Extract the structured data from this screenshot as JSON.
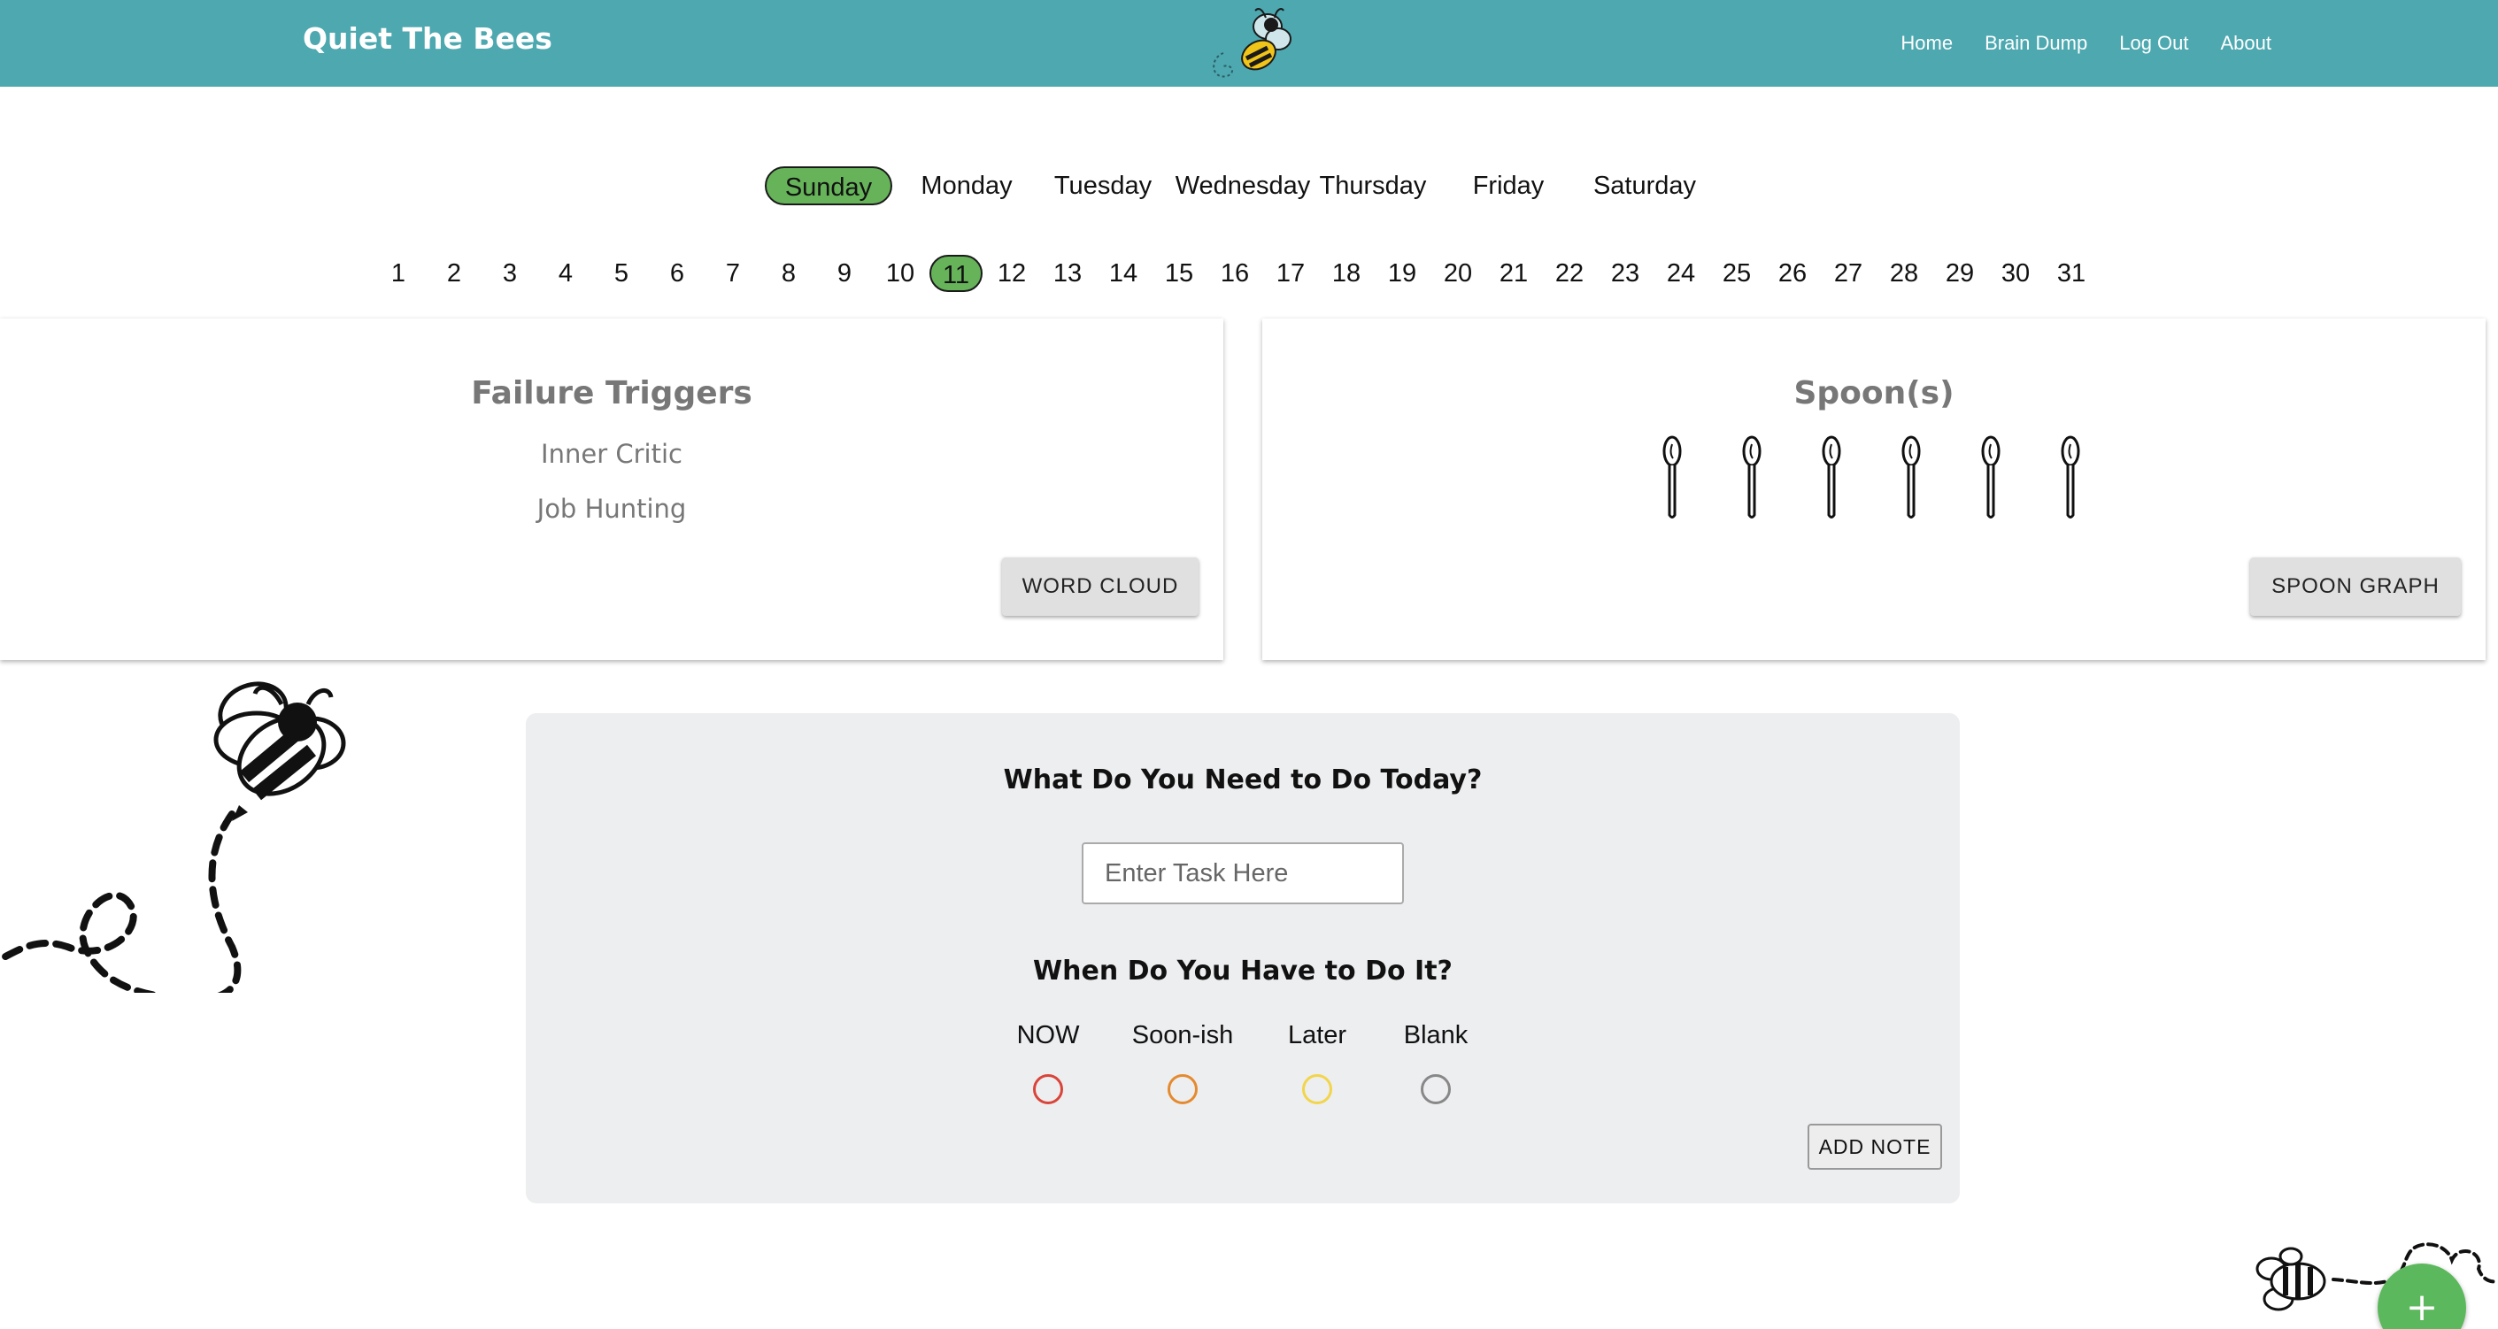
{
  "brand": "Quiet The Bees",
  "nav": {
    "links": [
      "Home",
      "Brain Dump",
      "Log Out",
      "About"
    ]
  },
  "week": {
    "days": [
      "Sunday",
      "Monday",
      "Tuesday",
      "Wednesday",
      "Thursday",
      "Friday",
      "Saturday"
    ],
    "selected": "Sunday"
  },
  "month": {
    "dates": [
      "1",
      "2",
      "3",
      "4",
      "5",
      "6",
      "7",
      "8",
      "9",
      "10",
      "11",
      "12",
      "13",
      "14",
      "15",
      "16",
      "17",
      "18",
      "19",
      "20",
      "21",
      "22",
      "23",
      "24",
      "25",
      "26",
      "27",
      "28",
      "29",
      "30",
      "31"
    ],
    "selected": "11"
  },
  "failure_triggers": {
    "title": "Failure Triggers",
    "items": [
      "Inner Critic",
      "Job Hunting"
    ],
    "button": "WORD CLOUD"
  },
  "spoons": {
    "title": "Spoon(s)",
    "count": 6,
    "button": "SPOON GRAPH"
  },
  "task": {
    "heading": "What Do You Need to Do Today?",
    "placeholder": "Enter Task Here",
    "when_heading": "When Do You Have to Do It?",
    "options": [
      {
        "label": "NOW",
        "color": "#d9453a"
      },
      {
        "label": "Soon-ish",
        "color": "#e58a2e"
      },
      {
        "label": "Later",
        "color": "#f2d54a"
      },
      {
        "label": "Blank",
        "color": "#888888"
      }
    ],
    "add_button": "ADD NOTE"
  },
  "fab": "+",
  "colors": {
    "navbar": "#4da8b0",
    "active_pill": "#66b35a",
    "panel": "#edeef0",
    "fab": "#5cb85c"
  }
}
